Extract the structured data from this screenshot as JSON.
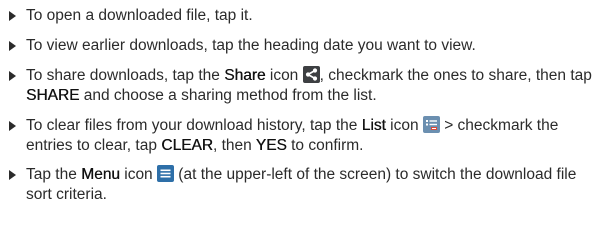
{
  "items": [
    {
      "p1": "To open a downloaded file, tap it."
    },
    {
      "p1": "To view earlier downloads, tap the heading date you want to view."
    },
    {
      "p1": "To share downloads, tap the ",
      "k1": "Share",
      "p2": " icon ",
      "icon": "share-icon",
      "p3": ", checkmark the ones to share, then tap ",
      "k2": "SHARE",
      "p4": " and choose a sharing method from the list."
    },
    {
      "p1": "To clear files from your download history, tap the ",
      "k1": "List",
      "p2": " icon ",
      "icon": "list-icon",
      "p3": " > checkmark the entries to clear, tap ",
      "k2": "CLEAR",
      "p4": ", then ",
      "k3": "YES",
      "p5": " to confirm."
    },
    {
      "p1": "Tap the ",
      "k1": "Menu",
      "p2": " icon ",
      "icon": "menu-icon",
      "p3": " (at the upper-left of the screen) to switch the download file sort criteria."
    }
  ],
  "colors": {
    "text": "#2b2b2b",
    "share_icon_bg": "#3d3f42",
    "list_icon_bg": "#6b8fb0",
    "menu_icon_bg": "#2e6fa8"
  }
}
